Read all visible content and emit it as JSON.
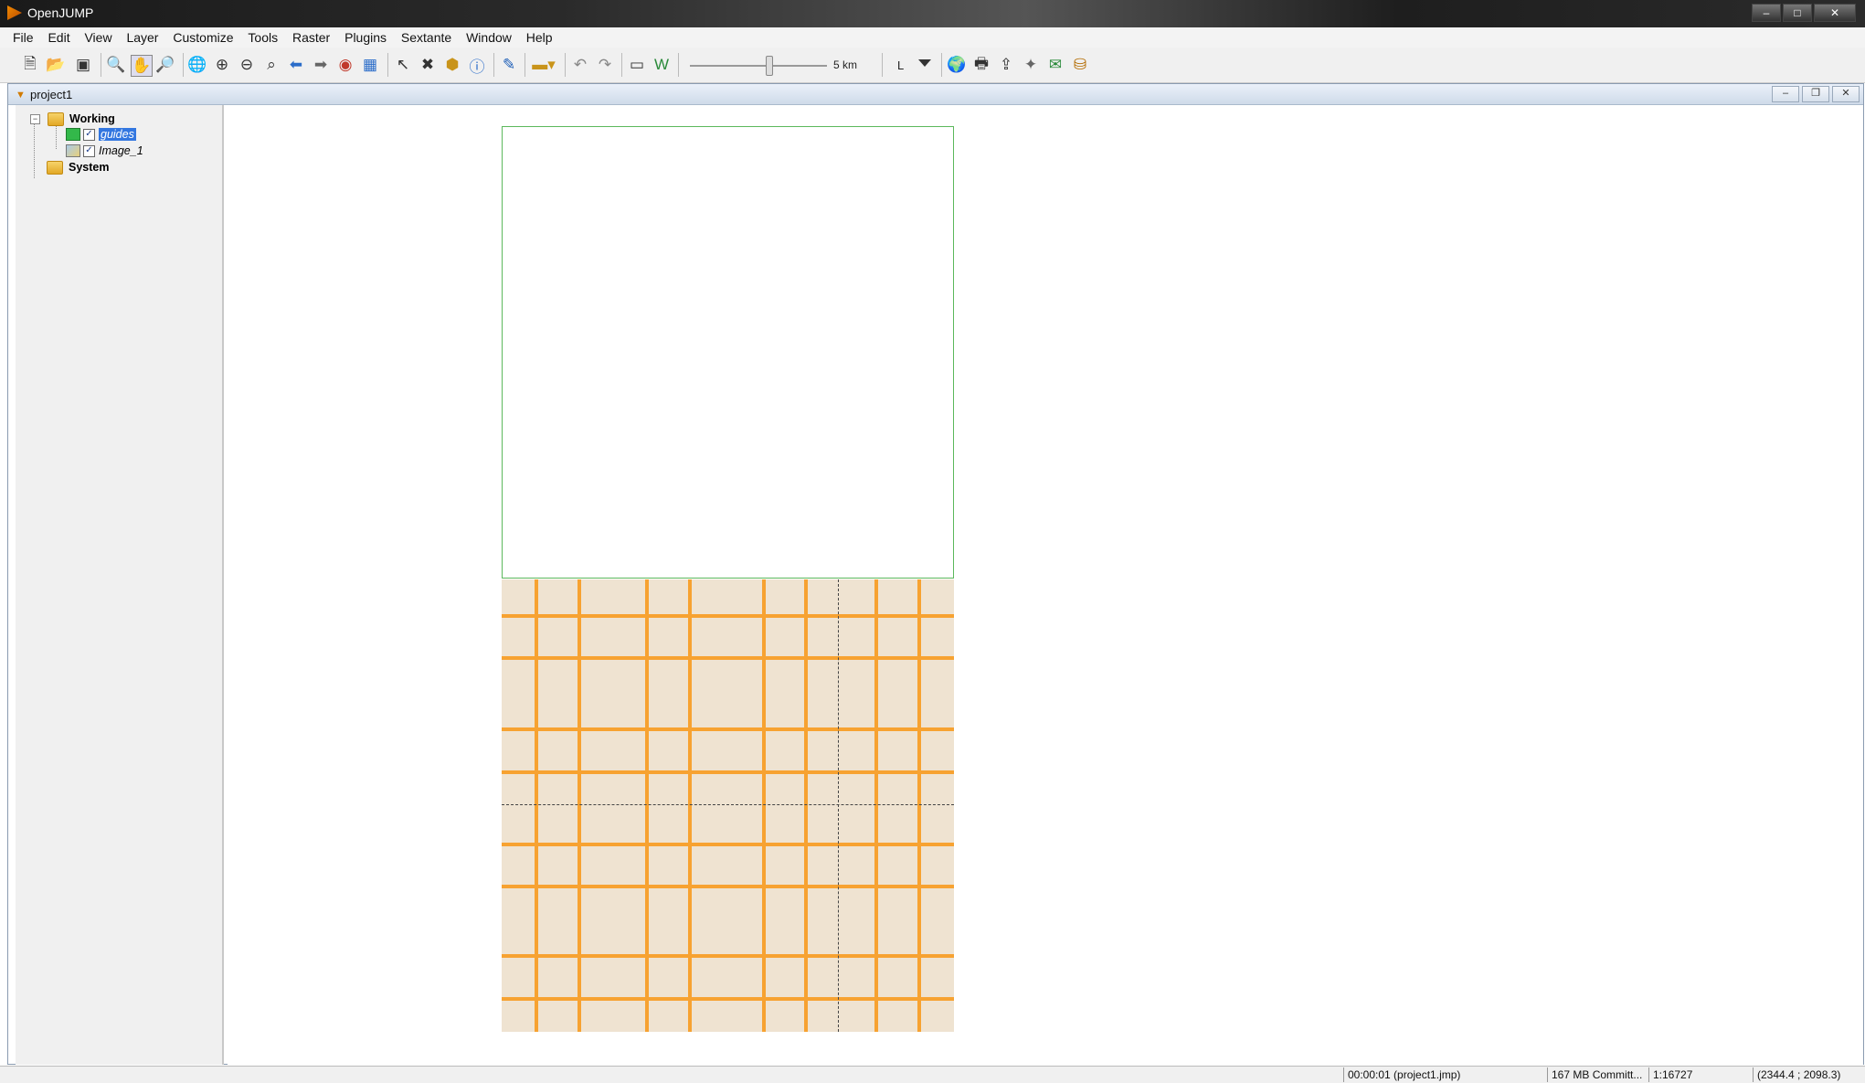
{
  "app": {
    "title": "OpenJUMP",
    "window_controls": [
      "–",
      "□",
      "✕"
    ]
  },
  "menu": [
    "File",
    "Edit",
    "View",
    "Layer",
    "Customize",
    "Tools",
    "Raster",
    "Plugins",
    "Sextante",
    "Window",
    "Help"
  ],
  "toolbar": {
    "icons": [
      "new-project-icon",
      "open-icon",
      "save-icon",
      "zoom-icon",
      "pan-icon",
      "zoom-tool-icon",
      "globe-icon",
      "zoom-in-icon",
      "zoom-out-icon",
      "zoom-prev-icon",
      "back-arrow-icon",
      "forward-arrow-icon",
      "zoom-layer-icon",
      "grid-icon",
      "select-icon",
      "delete-icon",
      "feature-box-icon",
      "info-icon",
      "edit-icon",
      "measure-icon",
      "undo-icon",
      "redo-icon",
      "fence-icon",
      "wms-icon"
    ],
    "scale_text": "5 km",
    "combo_value": "L",
    "right_icons": [
      "layer-color-icon",
      "print-icon",
      "export-icon",
      "compass-icon",
      "wfs-icon",
      "database-icon"
    ]
  },
  "project": {
    "title": "project1",
    "frame_controls": [
      "–",
      "❐",
      "✕"
    ]
  },
  "layer_tree": {
    "categories": [
      {
        "name": "Working",
        "expanded": true,
        "layers": [
          {
            "name": "guides",
            "checked": true,
            "selected": true,
            "type": "vector"
          },
          {
            "name": "Image_1",
            "checked": true,
            "selected": false,
            "type": "image"
          }
        ]
      },
      {
        "name": "System",
        "expanded": false,
        "layers": []
      }
    ]
  },
  "colors": {
    "guide_outline": "#5cb85c",
    "image_background": "#efe3d1",
    "grid_lines": "#f7a231"
  },
  "statusbar": {
    "time": "00:00:01 (project1.jmp)",
    "memory": "167 MB Committ...",
    "scale": "1:16727",
    "coords": "(2344.4 ; 2098.3)"
  }
}
